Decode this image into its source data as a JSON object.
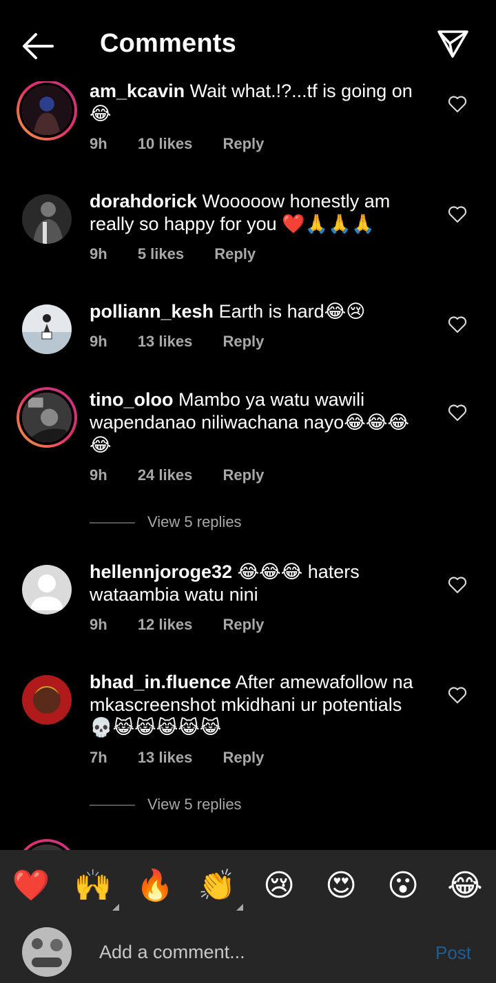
{
  "header": {
    "title": "Comments"
  },
  "comments": [
    {
      "username": "am_kcavin",
      "text": "Wait what.!?...tf is going on 😂",
      "time": "9h",
      "likes": "10 likes",
      "reply": "Reply"
    },
    {
      "username": "dorahdorick",
      "text": "Wooooow honestly am really so happy for you ❤️🙏🙏🙏",
      "time": "9h",
      "likes": "5 likes",
      "reply": "Reply"
    },
    {
      "username": "polliann_kesh",
      "text": "Earth is hard😂😢",
      "time": "9h",
      "likes": "13 likes",
      "reply": "Reply"
    },
    {
      "username": "tino_oloo",
      "text": "Mambo ya watu wawili wapendanao niliwachana nayo😂😂😂😂",
      "time": "9h",
      "likes": "24 likes",
      "reply": "Reply",
      "view_replies": "View 5 replies"
    },
    {
      "username": "hellennjoroge32",
      "text": "😂😂😂 haters wataambia watu nini",
      "time": "9h",
      "likes": "12 likes",
      "reply": "Reply"
    },
    {
      "username": "bhad_in.fluence",
      "text": "After amewafollow na mkascreenshot mkidhani ur potentials 💀😹😹😹😹😹",
      "time": "7h",
      "likes": "13 likes",
      "reply": "Reply",
      "view_replies": "View 5 replies"
    }
  ],
  "emoji_bar": [
    "❤️",
    "🙌",
    "🔥",
    "👏",
    "😢",
    "😍",
    "😮",
    "😂"
  ],
  "composer": {
    "placeholder": "Add a comment...",
    "post_label": "Post"
  },
  "colors": {
    "background": "#000000",
    "muted": "#a8a8a8",
    "bar": "#262626",
    "post": "#1a5f96",
    "story_ring": "#e1306c"
  }
}
